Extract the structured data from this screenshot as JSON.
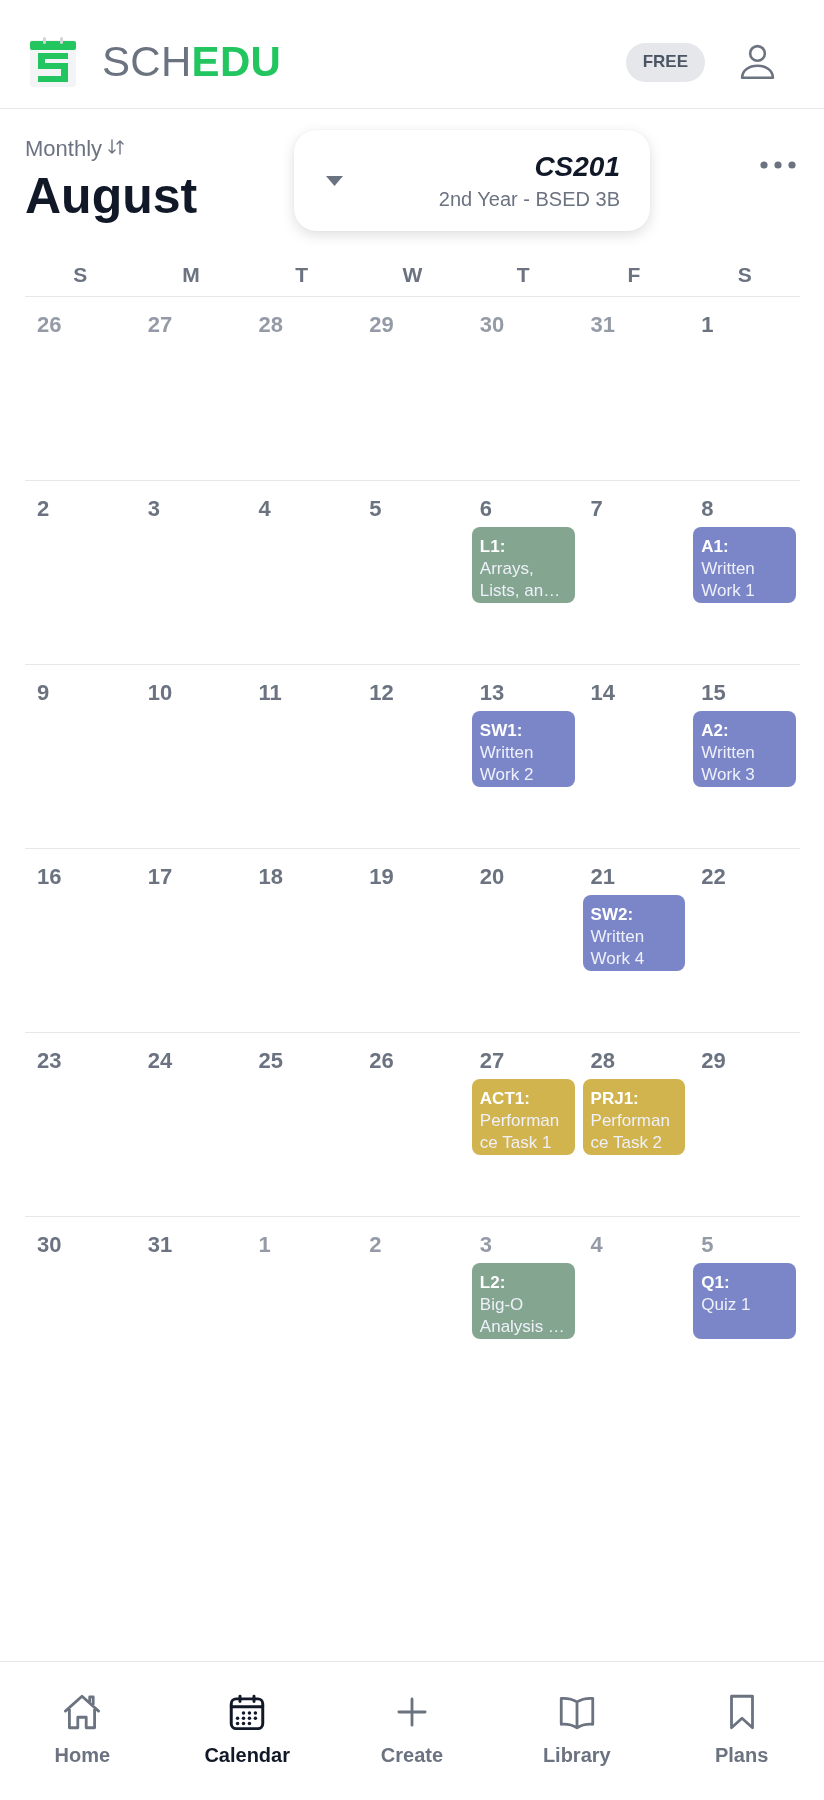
{
  "header": {
    "brand": {
      "lead": "SCH",
      "accent": "EDU"
    },
    "plan_badge": "FREE"
  },
  "view": {
    "mode": "Monthly",
    "month": "August"
  },
  "class_selector": {
    "code": "CS201",
    "section": "2nd Year - BSED 3B"
  },
  "calendar": {
    "weekdays": [
      "S",
      "M",
      "T",
      "W",
      "T",
      "F",
      "S"
    ],
    "weeks": [
      [
        {
          "day": "26",
          "current_month": false
        },
        {
          "day": "27",
          "current_month": false
        },
        {
          "day": "28",
          "current_month": false
        },
        {
          "day": "29",
          "current_month": false
        },
        {
          "day": "30",
          "current_month": false
        },
        {
          "day": "31",
          "current_month": false
        },
        {
          "day": "1",
          "current_month": true
        }
      ],
      [
        {
          "day": "2",
          "current_month": true
        },
        {
          "day": "3",
          "current_month": true
        },
        {
          "day": "4",
          "current_month": true
        },
        {
          "day": "5",
          "current_month": true
        },
        {
          "day": "6",
          "current_month": true,
          "events": [
            {
              "code": "L1:",
              "title": "Arrays, Lists, an…",
              "color": "#84a590"
            }
          ]
        },
        {
          "day": "7",
          "current_month": true
        },
        {
          "day": "8",
          "current_month": true,
          "events": [
            {
              "code": "A1:",
              "title": "Written Work 1",
              "color": "#7b86c8"
            }
          ]
        }
      ],
      [
        {
          "day": "9",
          "current_month": true
        },
        {
          "day": "10",
          "current_month": true
        },
        {
          "day": "11",
          "current_month": true
        },
        {
          "day": "12",
          "current_month": true
        },
        {
          "day": "13",
          "current_month": true,
          "events": [
            {
              "code": "SW1:",
              "title": "Written Work 2",
              "color": "#7b86c8"
            }
          ]
        },
        {
          "day": "14",
          "current_month": true
        },
        {
          "day": "15",
          "current_month": true,
          "events": [
            {
              "code": "A2:",
              "title": "Written Work 3",
              "color": "#7b86c8"
            }
          ]
        }
      ],
      [
        {
          "day": "16",
          "current_month": true
        },
        {
          "day": "17",
          "current_month": true
        },
        {
          "day": "18",
          "current_month": true
        },
        {
          "day": "19",
          "current_month": true
        },
        {
          "day": "20",
          "current_month": true
        },
        {
          "day": "21",
          "current_month": true,
          "events": [
            {
              "code": "SW2:",
              "title": "Written Work 4",
              "color": "#7b86c8"
            }
          ]
        },
        {
          "day": "22",
          "current_month": true
        }
      ],
      [
        {
          "day": "23",
          "current_month": true
        },
        {
          "day": "24",
          "current_month": true
        },
        {
          "day": "25",
          "current_month": true
        },
        {
          "day": "26",
          "current_month": true
        },
        {
          "day": "27",
          "current_month": true,
          "events": [
            {
              "code": "ACT1:",
              "title": "Performance Task 1",
              "color": "#d2b44e"
            }
          ]
        },
        {
          "day": "28",
          "current_month": true,
          "events": [
            {
              "code": "PRJ1:",
              "title": "Performance Task 2",
              "color": "#d2b44e"
            }
          ]
        },
        {
          "day": "29",
          "current_month": true
        }
      ],
      [
        {
          "day": "30",
          "current_month": true
        },
        {
          "day": "31",
          "current_month": true
        },
        {
          "day": "1",
          "current_month": false
        },
        {
          "day": "2",
          "current_month": false
        },
        {
          "day": "3",
          "current_month": false,
          "events": [
            {
              "code": "L2:",
              "title": "Big-O Analysis …",
              "color": "#84a590"
            }
          ]
        },
        {
          "day": "4",
          "current_month": false
        },
        {
          "day": "5",
          "current_month": false,
          "events": [
            {
              "code": "Q1:",
              "title": "Quiz 1",
              "color": "#7b86c8"
            }
          ]
        }
      ]
    ]
  },
  "nav": [
    {
      "label": "Home",
      "selected": false
    },
    {
      "label": "Calendar",
      "selected": true
    },
    {
      "label": "Create",
      "selected": false
    },
    {
      "label": "Library",
      "selected": false
    },
    {
      "label": "Plans",
      "selected": false
    }
  ]
}
